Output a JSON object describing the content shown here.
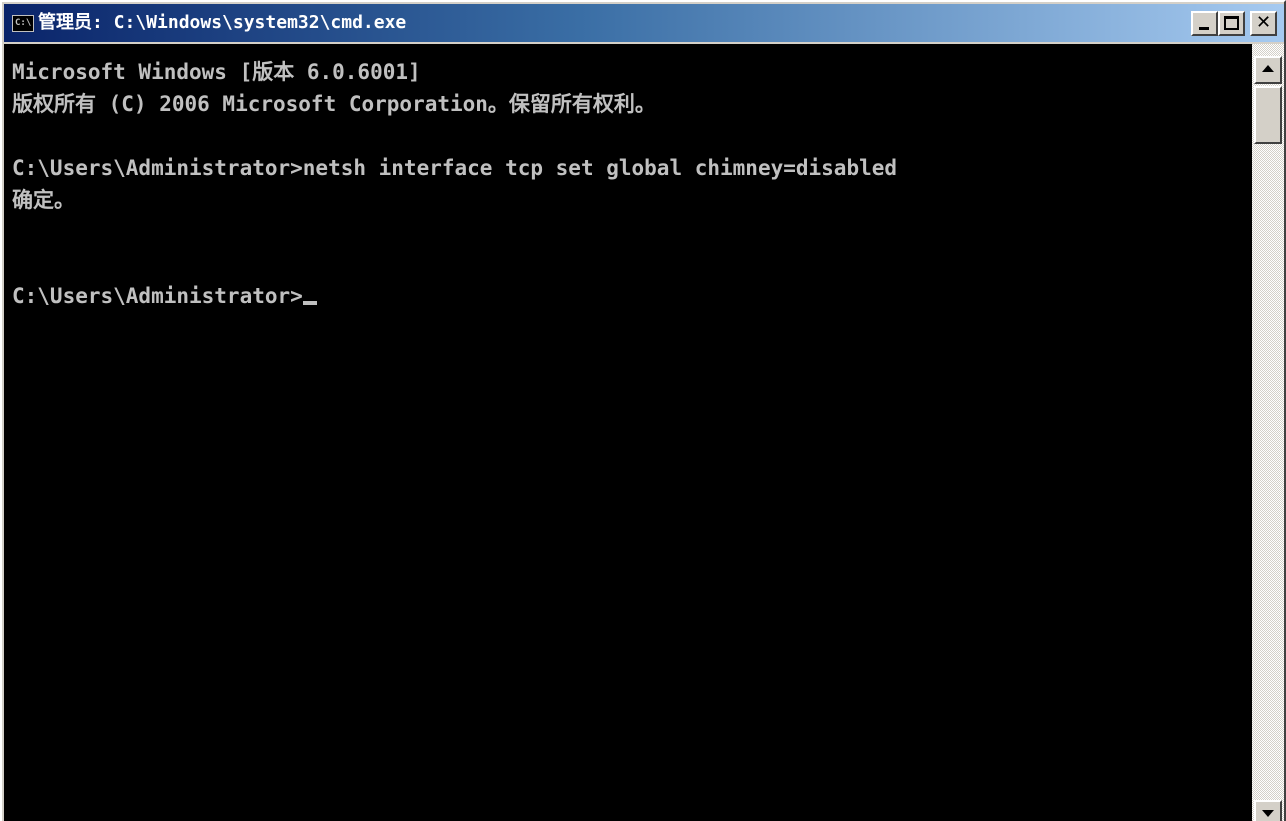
{
  "window": {
    "title": "管理员: C:\\Windows\\system32\\cmd.exe",
    "icon_text": "C:\\",
    "icon": "console-app-icon",
    "buttons": {
      "minimize_icon": "minimize-icon",
      "maximize_icon": "maximize-icon",
      "close_label": "✕",
      "close_icon": "close-icon"
    }
  },
  "console": {
    "lines": [
      "Microsoft Windows [版本 6.0.6001]",
      "版权所有 (C) 2006 Microsoft Corporation。保留所有权利。",
      "",
      "C:\\Users\\Administrator>netsh interface tcp set global chimney=disabled",
      "确定。",
      "",
      "",
      "C:\\Users\\Administrator>"
    ],
    "background_color": "#000000",
    "text_color": "#c0c0c0"
  },
  "scrollbar": {
    "up_icon": "scroll-up-arrow-icon",
    "down_icon": "scroll-down-arrow-icon"
  },
  "colors": {
    "titlebar_start": "#0a246a",
    "titlebar_end": "#a6caf0",
    "chrome": "#d4d0c8"
  }
}
